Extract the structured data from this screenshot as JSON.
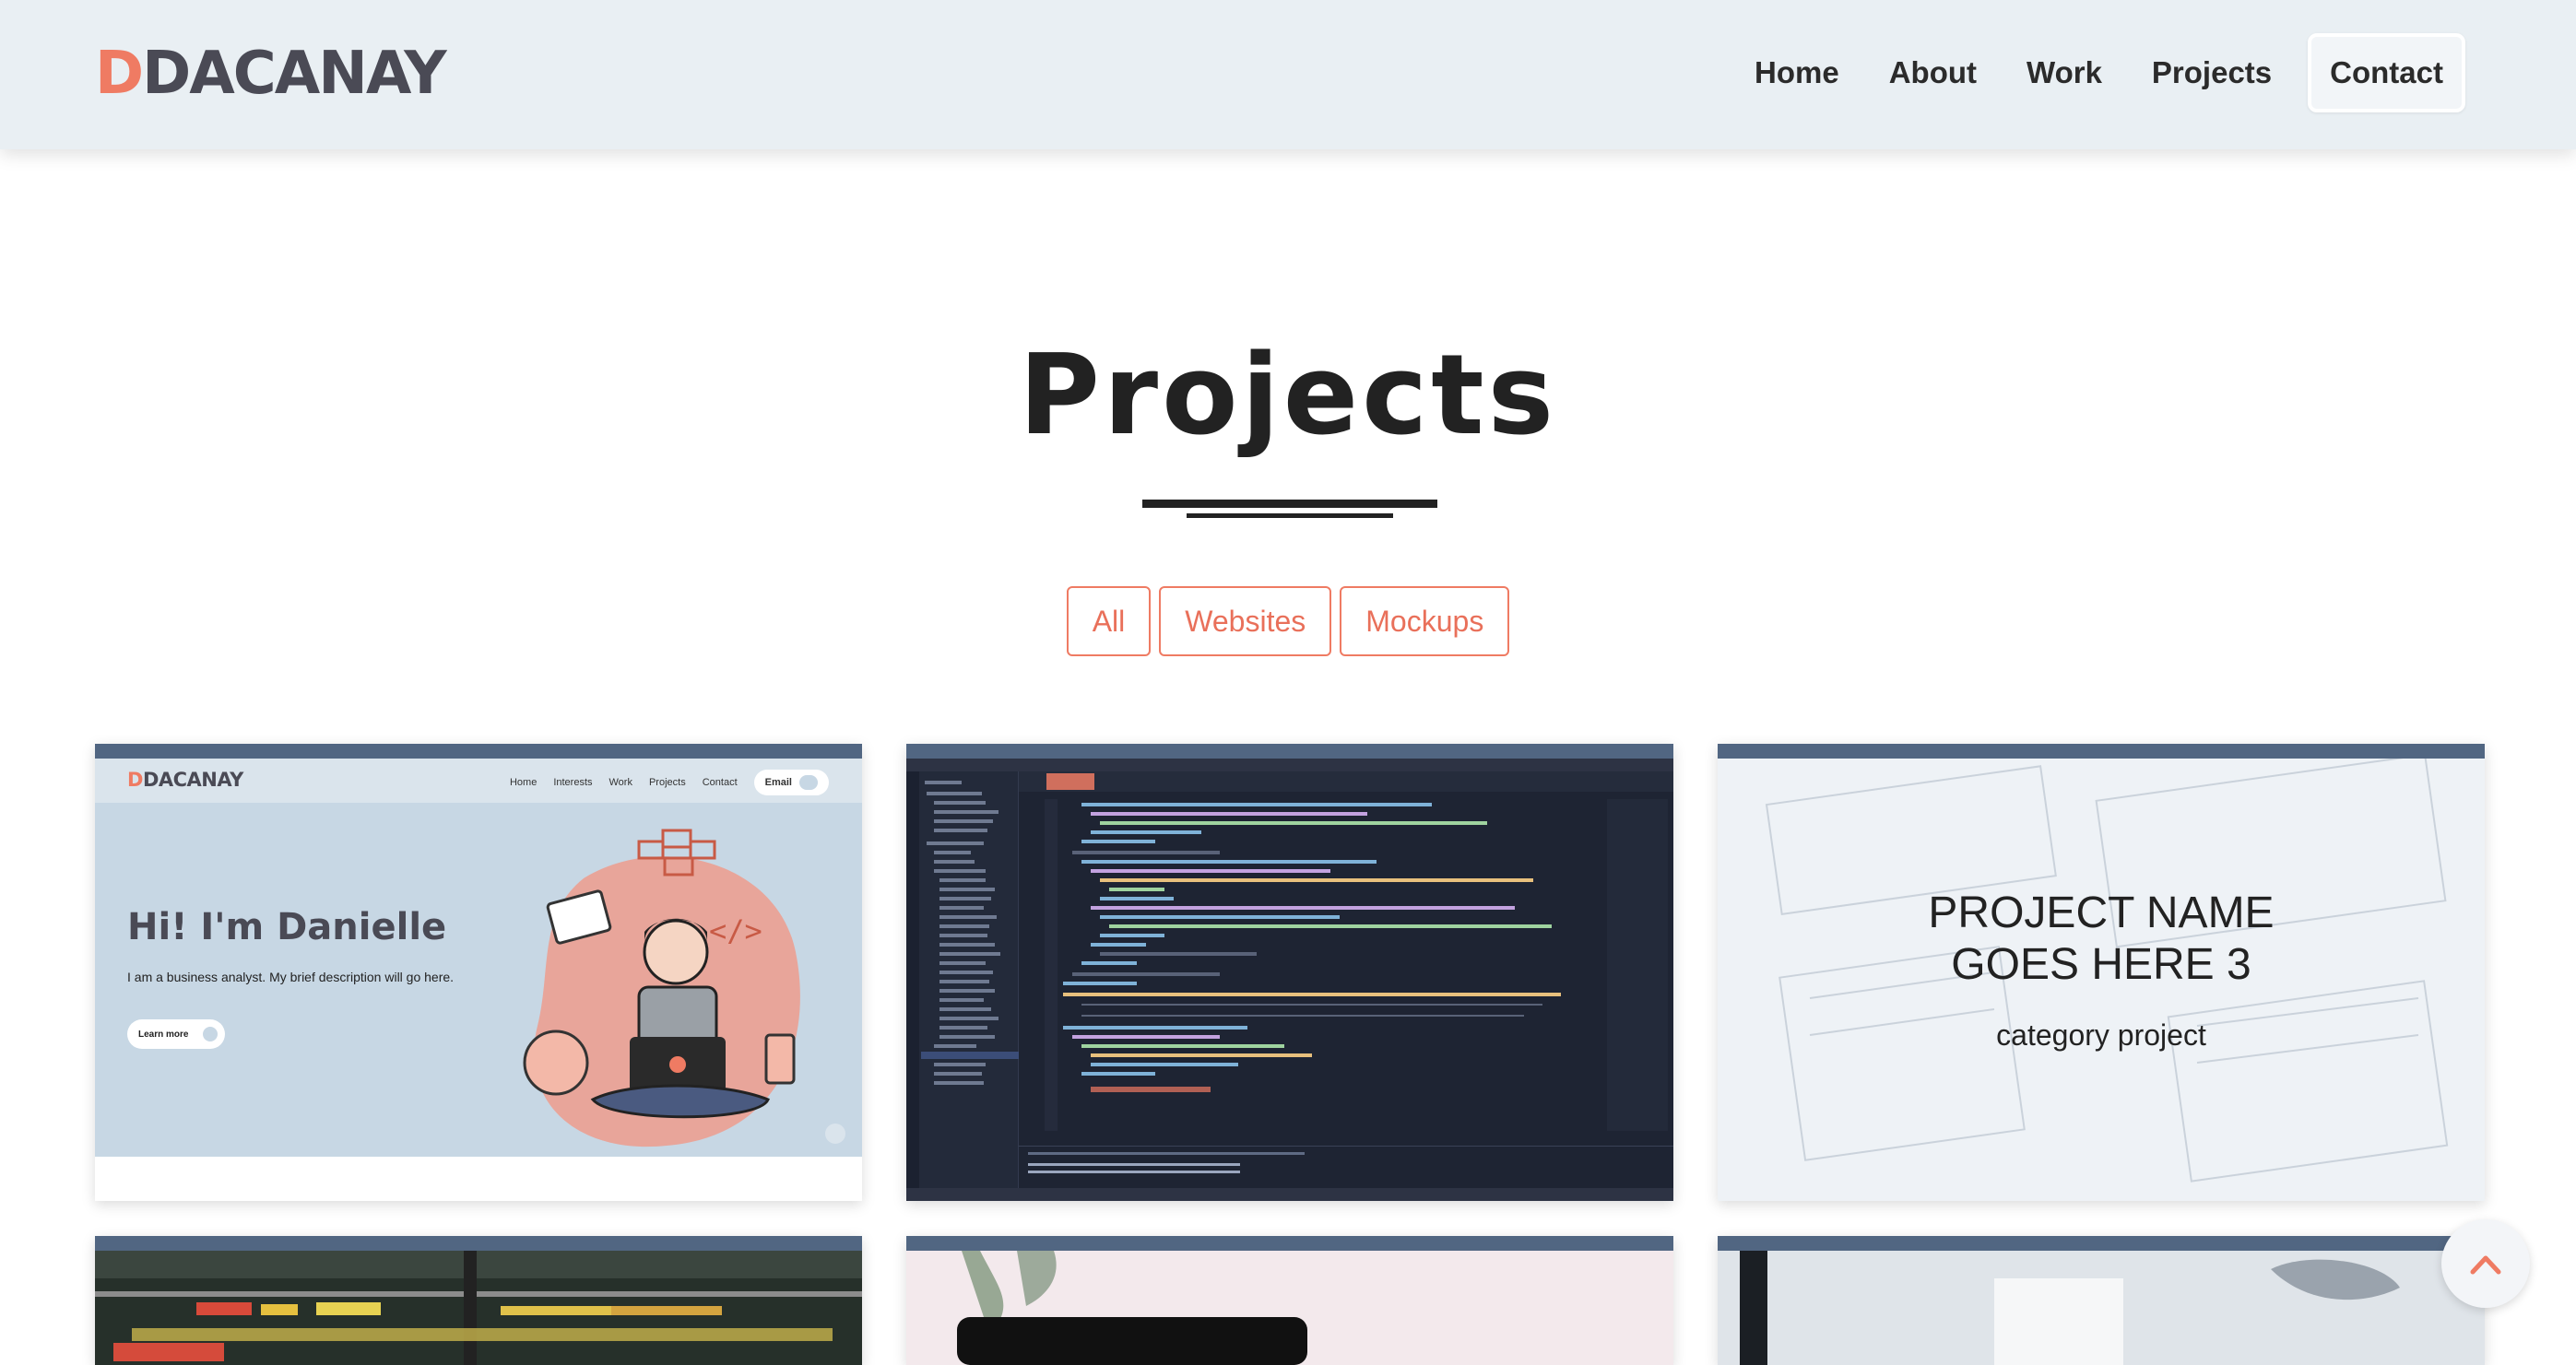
{
  "brand": {
    "logo_initial": "D",
    "logo_rest": "DACANAY"
  },
  "nav": {
    "items": [
      {
        "label": "Home"
      },
      {
        "label": "About"
      },
      {
        "label": "Work"
      },
      {
        "label": "Projects"
      }
    ],
    "contact_label": "Contact"
  },
  "section": {
    "title": "Projects"
  },
  "filters": [
    {
      "label": "All"
    },
    {
      "label": "Websites"
    },
    {
      "label": "Mockups"
    }
  ],
  "cards": [
    {
      "thumb": {
        "logo_initial": "D",
        "logo_rest": "DACANAY",
        "nav": [
          "Home",
          "Interests",
          "Work",
          "Projects",
          "Contact"
        ],
        "email_label": "Email",
        "headline": "Hi! I'm Danielle",
        "description": "I am a business analyst. My brief description will go here.",
        "button_label": "Learn more"
      }
    },
    {
      "thumb": {
        "kind": "code editor screenshot"
      }
    },
    {
      "title_line1": "PROJECT NAME",
      "title_line2": "GOES HERE 3",
      "category": "category project"
    }
  ],
  "colors": {
    "accent": "#ef7b63",
    "card_bar": "#516682",
    "navbar_bg": "#e9eff3"
  },
  "icons": {
    "scroll_top": "chevron-up-icon"
  }
}
